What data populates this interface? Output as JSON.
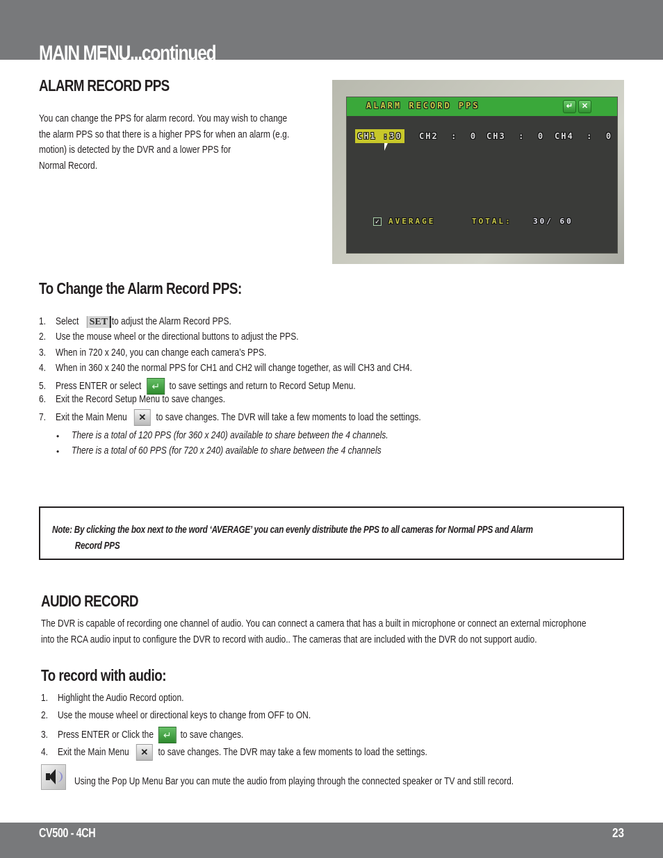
{
  "header": {
    "title": "MAIN MENU...continued"
  },
  "alarm_record_pps": {
    "heading": "ALARM RECORD PPS",
    "description_lines": [
      "You can change the PPS for alarm record. You may wish to change",
      "the alarm PPS so that there is a higher PPS for when an alarm (e.g.",
      "motion) is detected by the DVR and a lower PPS for",
      "Normal Record."
    ]
  },
  "dvr_screen": {
    "title": "ALARM RECORD PPS",
    "enter_icon": "enter-icon",
    "close_icon": "close-icon",
    "channels": [
      {
        "label": "CH1",
        "separator": ":",
        "value": "30",
        "selected": true
      },
      {
        "label": "CH2",
        "separator": ":",
        "value": "0",
        "selected": false
      },
      {
        "label": "CH3",
        "separator": ":",
        "value": "0",
        "selected": false
      },
      {
        "label": "CH4",
        "separator": ":",
        "value": "0",
        "selected": false
      }
    ],
    "average_label": "AVERAGE",
    "average_checked": true,
    "total_label": "TOTAL:",
    "total_value": "30/ 60",
    "colors": {
      "titlebar": "#3aa83a",
      "panel": "#3a3b39",
      "selection": "#c8c82a",
      "label_text": "#c8d24a"
    }
  },
  "change_pps": {
    "heading": "To Change the Alarm Record PPS:",
    "steps": [
      {
        "num": "1.",
        "before": "Select",
        "icon": "set-icon",
        "icon_label": "SET",
        "after": "to adjust the Alarm Record PPS."
      },
      {
        "num": "2.",
        "text": "Use the mouse wheel or the directional buttons to adjust the PPS."
      },
      {
        "num": "3.",
        "text": "When in 720 x 240, you can change each camera’s PPS."
      },
      {
        "num": "4.",
        "text": "When in 360 x 240 the normal PPS for CH1 and CH2 will change together, as will CH3 and CH4."
      },
      {
        "num": "5.",
        "before": "Press ENTER or select",
        "icon": "enter-icon",
        "after": "to save settings and return to Record Setup Menu."
      },
      {
        "num": "6.",
        "text": "Exit the Record Setup Menu to save changes."
      },
      {
        "num": "7.",
        "before": "Exit the Main Menu",
        "icon": "close-icon",
        "after": "to save changes. The DVR will take a few moments to load the settings."
      }
    ],
    "notes": [
      "There is a total of 120 PPS (for 360 x 240) available to share between the 4 channels.",
      "There is a total of 60 PPS (for 720 x 240) available to share between the 4 channels"
    ]
  },
  "note_box": {
    "line1": "Note: By clicking the box next to the word  ‘AVERAGE’ you can evenly distribute the PPS to all cameras for Normal PPS and Alarm",
    "line2": "Record PPS"
  },
  "audio_record": {
    "heading": "AUDIO RECORD",
    "description_lines": [
      "The DVR is capable of recording one channel of audio. You can connect a camera that has a built in microphone or connect an external microphone",
      "into the RCA audio input to configure the DVR to record with audio.. The cameras that are included with the DVR do not support audio."
    ],
    "subheading": "To record with audio:",
    "steps": [
      {
        "num": "1.",
        "text": "Highlight the Audio Record option."
      },
      {
        "num": "2.",
        "text": "Use the mouse wheel or directional keys to change from OFF to ON."
      },
      {
        "num": "3.",
        "before": "Press ENTER or Click the",
        "icon": "enter-icon",
        "after": "to save changes."
      },
      {
        "num": "4.",
        "before": "Exit the Main Menu",
        "icon": "close-icon",
        "after": "to save changes. The DVR may take a few moments to load the settings."
      }
    ],
    "mute_icon": "speaker-icon",
    "mute_note": "Using the Pop Up Menu Bar you can mute the audio from playing through the connected speaker or TV and still record."
  },
  "footer": {
    "model": "CV500 - 4CH",
    "page_number": "23"
  },
  "icons": {
    "enter_glyph": "↵",
    "close_glyph": "✕",
    "check_glyph": "✓"
  },
  "colors": {
    "band": "#78797b",
    "text": "#231f20"
  }
}
